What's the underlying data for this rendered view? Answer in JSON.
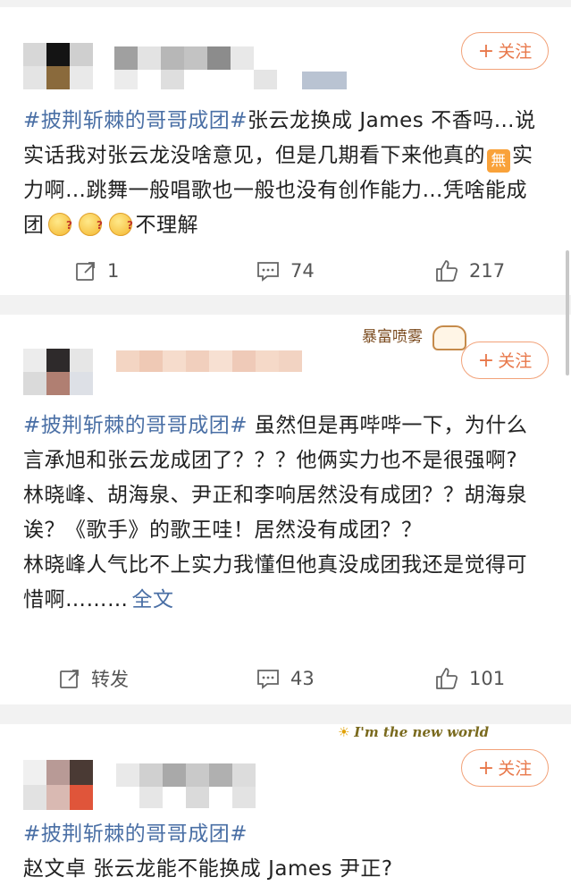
{
  "follow_label": "关注",
  "posts": [
    {
      "tag": "#披荆斩棘的哥哥成团#",
      "text_a": "张云龙换成 James 不香吗…说实话我对张云龙没啥意见，但是几期看下来他真的",
      "wu_char": "無",
      "text_b": "实力啊…跳舞一般唱歌也一般也没有创作能力…凭啥能成团",
      "text_c": "不理解",
      "actions": {
        "repost": "1",
        "comment": "74",
        "like": "217"
      }
    },
    {
      "decoration": "暴富喷雾",
      "tag": "#披荆斩棘的哥哥成团#",
      "text": " 虽然但是再哔哔一下，为什么言承旭和张云龙成团了？？？他俩实力也不是很强啊?",
      "line2": "林晓峰、胡海泉、尹正和李响居然没有成团？？胡海泉诶？《歌手》的歌王哇！居然没有成团？？",
      "line3": "林晓峰人气比不上实力我懂但他真没成团我还是觉得可惜啊………",
      "full_text_link": "全文",
      "actions": {
        "repost": "转发",
        "comment": "43",
        "like": "101"
      }
    },
    {
      "decoration": "I'm the new world",
      "tag": "#披荆斩棘的哥哥成团#",
      "text": "赵文卓 张云龙能不能换成 James 尹正?"
    }
  ]
}
